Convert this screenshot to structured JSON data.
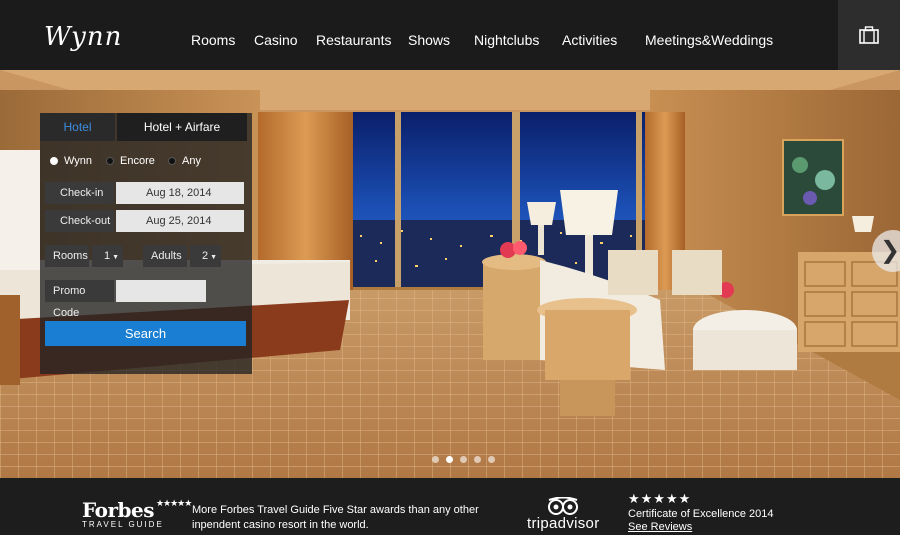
{
  "brand": {
    "logo": "Wynn"
  },
  "nav": {
    "items": [
      {
        "label": "Rooms"
      },
      {
        "label": "Casino"
      },
      {
        "label": "Restaurants"
      },
      {
        "label": "Shows"
      },
      {
        "label": "Nightclubs"
      },
      {
        "label": "Activities"
      },
      {
        "label": "Meetings&Weddings"
      }
    ],
    "cart_icon": "suitcase-icon"
  },
  "booking": {
    "tabs": [
      {
        "label": "Hotel",
        "active": true
      },
      {
        "label": "Hotel + Airfare",
        "active": false
      }
    ],
    "property_options": [
      {
        "label": "Wynn",
        "selected": true
      },
      {
        "label": "Encore",
        "selected": false
      },
      {
        "label": "Any",
        "selected": false
      }
    ],
    "checkin_label": "Check-in",
    "checkin_value": "Aug 18, 2014",
    "checkout_label": "Check-out",
    "checkout_value": "Aug 25, 2014",
    "rooms_label": "Rooms",
    "rooms_value": "1",
    "adults_label": "Adults",
    "adults_value": "2",
    "promo_label": "Promo Code",
    "promo_value": "",
    "search_label": "Search"
  },
  "carousel": {
    "slides": 5,
    "active_index": 1,
    "next_icon": "chevron-right-icon"
  },
  "footer": {
    "forbes_name": "Forbes",
    "forbes_sub": "TRAVEL GUIDE",
    "forbes_stars": "★★★★★",
    "forbes_text": "More Forbes Travel Guide  Five Star  awards than any other inpendent casino resort in the world.",
    "tripadvisor_name": "tripadvisor",
    "tripadvisor_stars": "★★★★★",
    "tripadvisor_cert": "Certificate of Excellence 2014",
    "tripadvisor_link": "See Reviews"
  },
  "colors": {
    "accent": "#1a7fd2",
    "active_tab_text": "#3d8de0",
    "header_bg": "#1b1b1b"
  }
}
